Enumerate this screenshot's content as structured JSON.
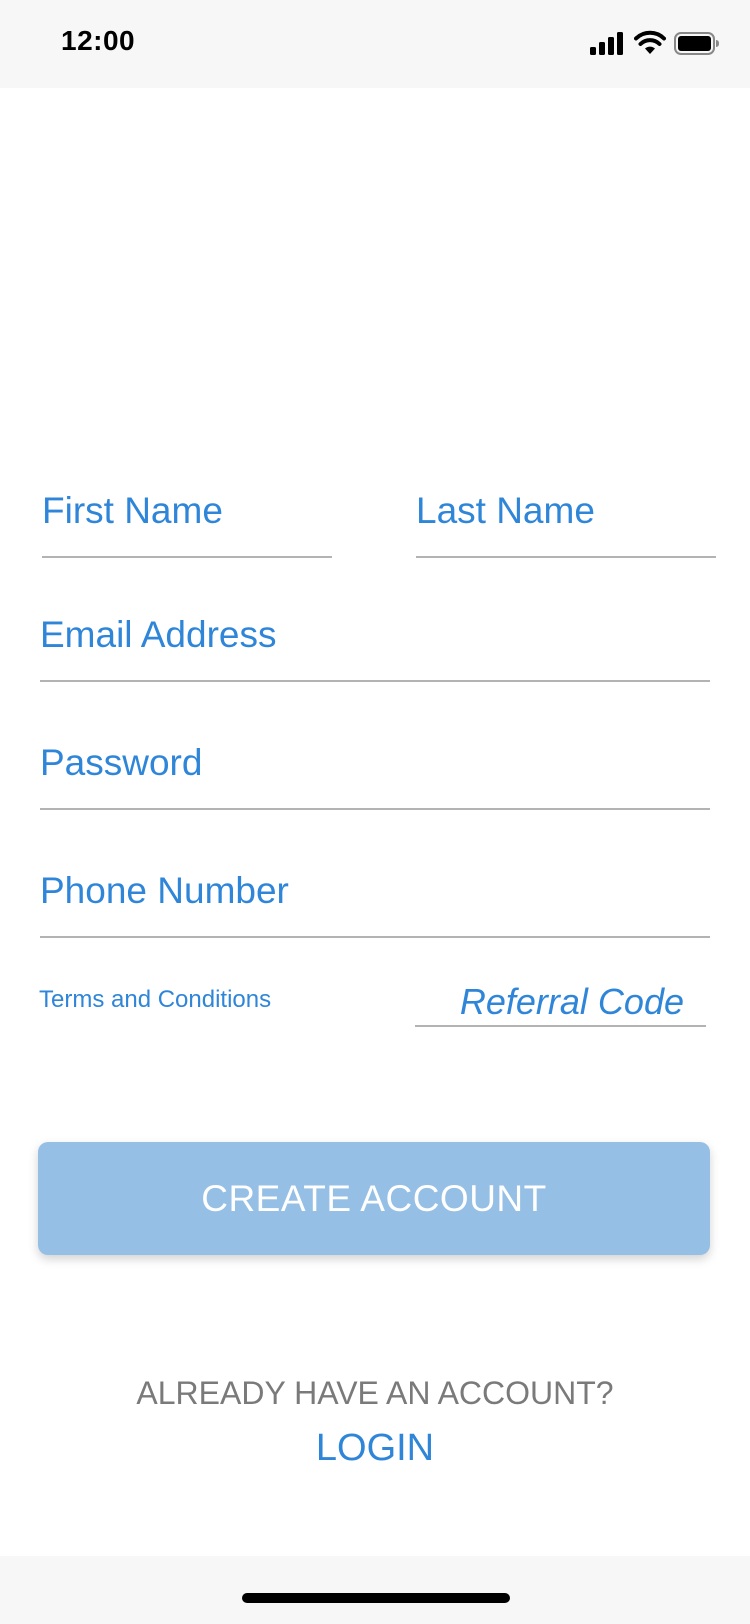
{
  "status_bar": {
    "time": "12:00",
    "icons": [
      "cellular-signal-icon",
      "wifi-icon",
      "battery-icon"
    ]
  },
  "form": {
    "first_name": {
      "placeholder": "First Name",
      "value": ""
    },
    "last_name": {
      "placeholder": "Last Name",
      "value": ""
    },
    "email": {
      "placeholder": "Email Address",
      "value": ""
    },
    "password": {
      "placeholder": "Password",
      "value": ""
    },
    "phone": {
      "placeholder": "Phone Number",
      "value": ""
    },
    "terms_label": "Terms and Conditions",
    "referral": {
      "placeholder": "Referral Code",
      "value": ""
    },
    "create_button_label": "CREATE ACCOUNT"
  },
  "footer": {
    "already_text": "ALREADY HAVE AN ACCOUNT?",
    "login_label": "LOGIN"
  },
  "colors": {
    "accent": "#2f86d8",
    "button_disabled": "#96bfe5",
    "muted_text": "#7a7a7a",
    "underline": "#b3b3b3",
    "chrome_background": "#f7f7f7"
  }
}
